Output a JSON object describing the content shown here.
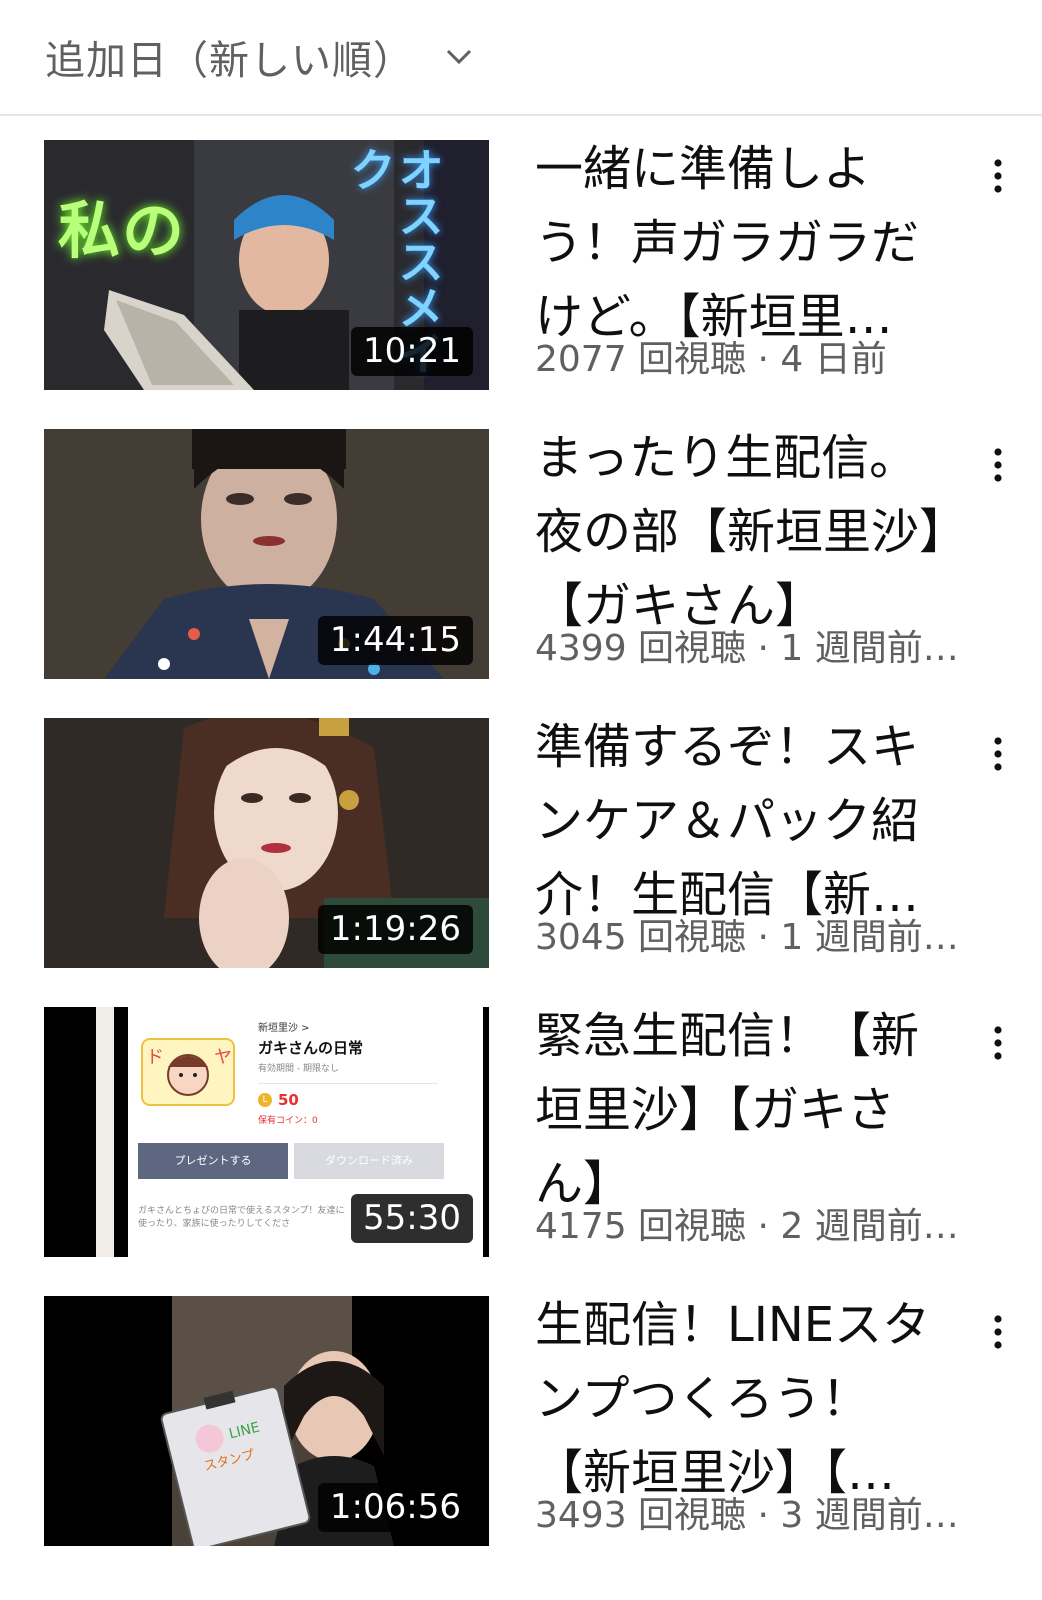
{
  "sort": {
    "label": "追加日（新しい順）",
    "icon": "chevron-down-icon"
  },
  "videos": [
    {
      "title": "一緒に準備しよう！声ガラガラだけど。【新垣里…",
      "duration": "10:21",
      "stats": "2077 回視聴 · 4 日前",
      "thumb_text_left": "私の",
      "thumb_text_right": "オススメイク"
    },
    {
      "title": "まったり生配信。夜の部【新垣里沙】【ガキさん】",
      "duration": "1:44:15",
      "stats": "4399 回視聴 · 1 週間前…"
    },
    {
      "title": "準備するぞ！スキンケア＆パック紹介！生配信【新…",
      "duration": "1:19:26",
      "stats": "3045 回視聴 · 1 週間前…"
    },
    {
      "title": "緊急生配信！【新垣里沙】【ガキさん】",
      "duration": "55:30",
      "stats": "4175 回視聴 · 2 週間前…",
      "thumb_card": {
        "breadcrumb": "新垣里沙 >",
        "name": "ガキさんの日常",
        "period": "有効期間 - 期限なし",
        "coins": "50",
        "owned": "保有コイン：0",
        "present_button": "プレゼントする",
        "download_button": "ダウンロード済み",
        "description": "ガキさんとちょびの日常で使えるスタンプ！友達に使ったり、家族に使ったりしてくださ"
      }
    },
    {
      "title": "生配信！LINEスタンプつくろう！【新垣里沙】【…",
      "duration": "1:06:56",
      "stats": "3493 回視聴 · 3 週間前…"
    }
  ]
}
